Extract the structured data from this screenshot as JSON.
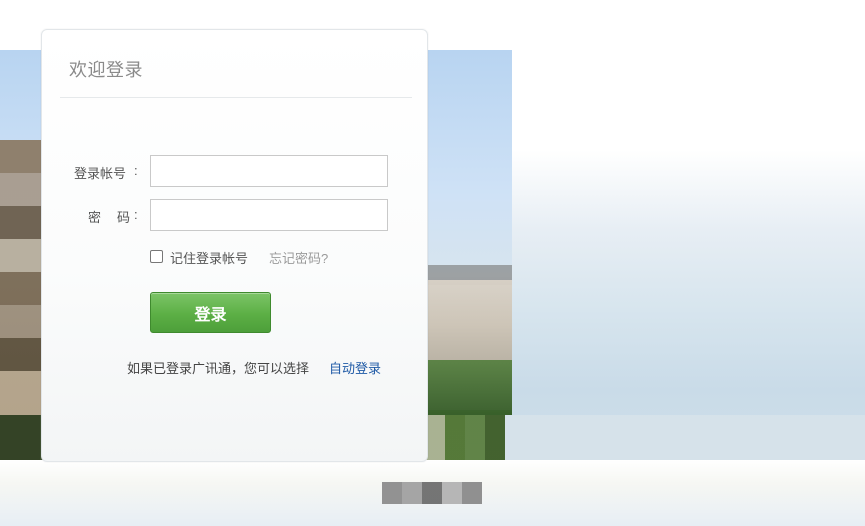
{
  "login": {
    "title": "欢迎登录",
    "account_label": "登录帐号",
    "account_value": "",
    "account_placeholder": "",
    "password_label": "密码",
    "password_value": "",
    "password_placeholder": "",
    "colon": ":",
    "remember_label": "记住登录帐号",
    "forgot_link": "忘记密码?",
    "submit_label": "登录",
    "auto_login_text": "如果已登录广讯通，您可以选择",
    "auto_login_link": "自动登录"
  },
  "colors": {
    "button_green": "#5caf45",
    "link_blue": "#1f5aa6",
    "title_gray": "#8a8a8a"
  },
  "icons": {
    "checkbox": "unchecked-checkbox"
  }
}
